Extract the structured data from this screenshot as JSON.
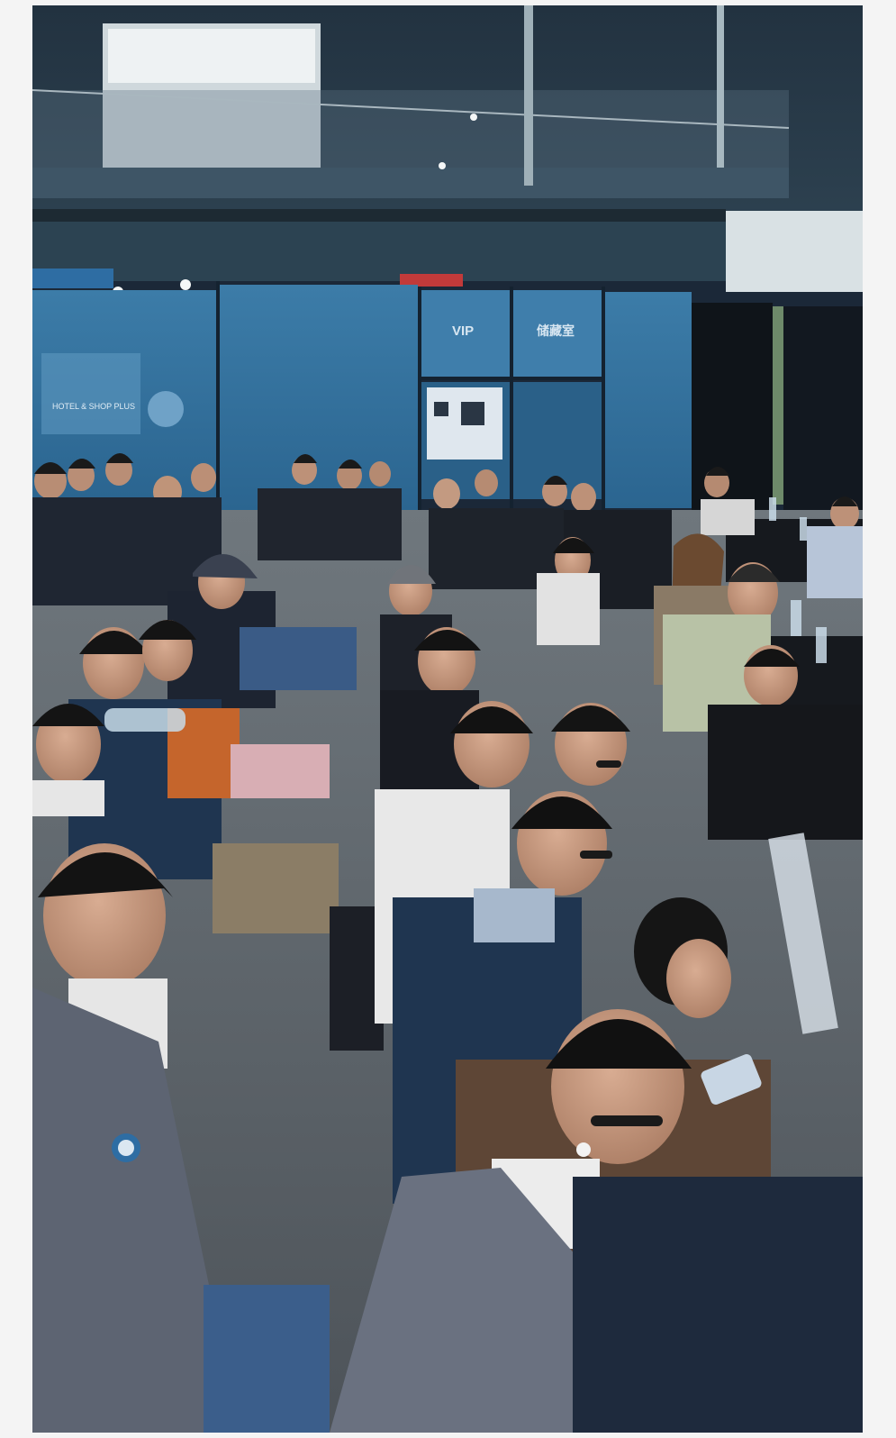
{
  "photo": {
    "signs": {
      "vip": "VIP",
      "storage": "储藏室",
      "hotel_banner": "HOTEL & SHOP PLUS"
    },
    "colors": {
      "wall_blue": "#2d6a95",
      "wall_blue_light": "#4b8ab7",
      "ceiling_dark": "#233746",
      "curtain": "#0f1419",
      "floor": "#7d8489",
      "jacket_dark": "#1c2230",
      "jacket_navy": "#1f3550",
      "skin": "#c79b82",
      "hair": "#141414",
      "shirt_white": "#e8e8e8",
      "shirt_green": "#b8c2a6",
      "suit_gray": "#5d6472"
    }
  }
}
